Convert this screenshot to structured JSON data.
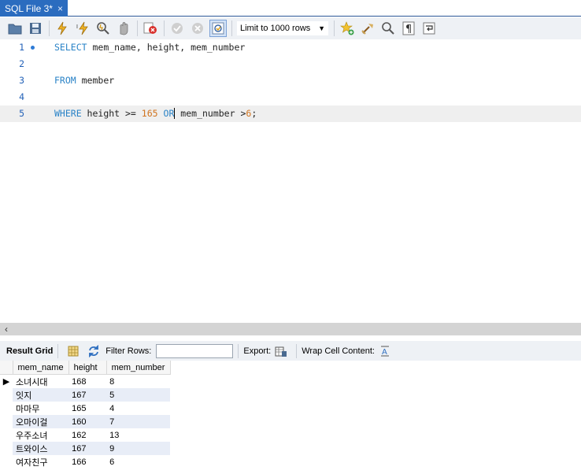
{
  "tab": {
    "title": "SQL File 3*",
    "close": "×"
  },
  "toolbar": {
    "limit_label": "Limit to 1000 rows"
  },
  "editor": {
    "line_numbers": [
      "1",
      "2",
      "3",
      "4",
      "5"
    ],
    "line1": {
      "kw1": "SELECT",
      "rest": " mem_name, height, mem_number"
    },
    "line3": {
      "kw": "FROM",
      "rest": " member"
    },
    "line5": {
      "kw1": "WHERE",
      "mid1": " height >= ",
      "num1": "165",
      "sp": " ",
      "kw2": "OR",
      "mid2": " mem_number >",
      "num2": "6",
      "end": ";"
    }
  },
  "result_bar": {
    "result_grid": "Result Grid",
    "filter_rows": "Filter Rows:",
    "export": "Export:",
    "wrap": "Wrap Cell Content:"
  },
  "grid": {
    "columns": [
      "mem_name",
      "height",
      "mem_number"
    ],
    "rows": [
      [
        "소녀시대",
        "168",
        "8"
      ],
      [
        "잇지",
        "167",
        "5"
      ],
      [
        "마마무",
        "165",
        "4"
      ],
      [
        "오마이걸",
        "160",
        "7"
      ],
      [
        "우주소녀",
        "162",
        "13"
      ],
      [
        "트와이스",
        "167",
        "9"
      ],
      [
        "여자친구",
        "166",
        "6"
      ]
    ]
  },
  "colors": {
    "tab": "#2b6cbf",
    "keyword": "#2a83c7",
    "number": "#d0731e",
    "line_number": "#2462b8"
  }
}
